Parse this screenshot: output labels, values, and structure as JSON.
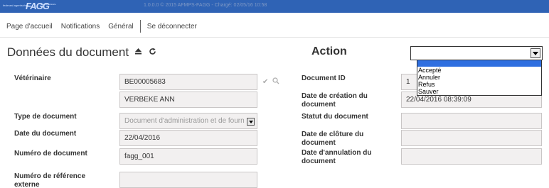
{
  "header": {
    "logo_text": "federaal agentschap",
    "logo_mark": "FAGG",
    "logo_sub": "agence fédérale",
    "version": "1.0.0.0 © 2015 AFMPS-FAGG - Chargé: 02/05/16 10:58"
  },
  "nav": {
    "items": [
      "Page d'accueil",
      "Notifications",
      "Général",
      "Se déconnecter"
    ]
  },
  "document_section": {
    "title": "Données du document",
    "eject_icon": "eject-icon",
    "refresh_icon": "refresh-icon"
  },
  "action": {
    "title": "Action",
    "selected": "",
    "options": [
      "Accepté",
      "Annuler",
      "Refus",
      "Sauver"
    ]
  },
  "left_form": {
    "veterinaire_label": "Vétérinaire",
    "veterinaire_id": "BE00005683",
    "veterinaire_name": "VERBEKE ANN",
    "type_label": "Type de document",
    "type_value": "Document d'administration et de fourn",
    "date_label": "Date du document",
    "date_value": "22/04/2016",
    "numero_label": "Numéro de document",
    "numero_value": "fagg_001",
    "reference_label": "Numéro de référence externe",
    "reference_value": ""
  },
  "right_form": {
    "doc_id_label": "Document ID",
    "doc_id_value": "1",
    "creation_label": "Date de création du document",
    "creation_value": "22/04/2016 08:39:09",
    "statut_label": "Statut du document",
    "statut_value": "",
    "cloture_label": "Date de clôture du document",
    "cloture_value": "",
    "annulation_label": "Date d'annulation du document",
    "annulation_value": ""
  },
  "colors": {
    "topbar": "#2f63b5",
    "dropdown_highlight": "#2f6fe0",
    "field_bg": "#f2f0f0"
  }
}
